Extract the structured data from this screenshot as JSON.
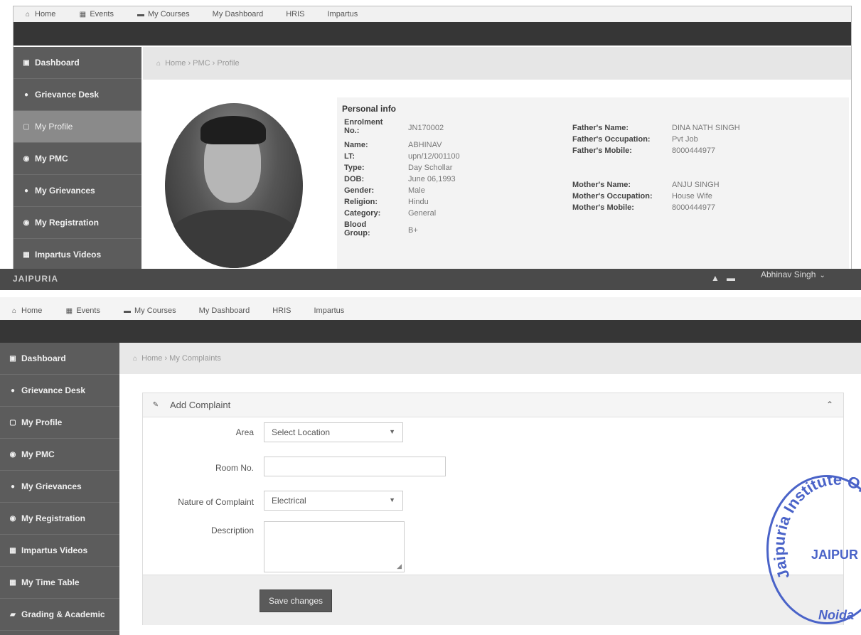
{
  "nav": {
    "home": "Home",
    "events": "Events",
    "courses": "My Courses",
    "dashboard": "My Dashboard",
    "hris": "HRIS",
    "impartus": "Impartus"
  },
  "sidebar_top": [
    {
      "label": "Dashboard",
      "icon": "dashboard-icon"
    },
    {
      "label": "Grievance Desk",
      "icon": "info-icon"
    },
    {
      "label": "My Profile",
      "icon": "file-icon"
    },
    {
      "label": "My PMC",
      "icon": "users-icon"
    },
    {
      "label": "My Grievances",
      "icon": "info-icon"
    },
    {
      "label": "My Registration",
      "icon": "users-icon"
    },
    {
      "label": "Impartus Videos",
      "icon": "calendar-icon"
    }
  ],
  "sidebar_bottom": [
    {
      "label": "Dashboard",
      "icon": "dashboard-icon"
    },
    {
      "label": "Grievance Desk",
      "icon": "info-icon"
    },
    {
      "label": "My Profile",
      "icon": "file-icon"
    },
    {
      "label": "My PMC",
      "icon": "users-icon"
    },
    {
      "label": "My Grievances",
      "icon": "info-icon"
    },
    {
      "label": "My Registration",
      "icon": "users-icon"
    },
    {
      "label": "Impartus Videos",
      "icon": "calendar-icon"
    },
    {
      "label": "My Time Table",
      "icon": "calendar-icon"
    },
    {
      "label": "Grading & Academic",
      "icon": "book-icon"
    }
  ],
  "breadcrumb_top": "Home  ›  PMC  ›  Profile",
  "breadcrumb_bottom": "Home  ›  My Complaints",
  "profile": {
    "title": "Personal info",
    "enrolment_label": "Enrolment No.:",
    "enrolment": "JN170002",
    "name_label": "Name:",
    "name": "ABHINAV",
    "lt_label": "LT:",
    "lt": "upn/12/001100",
    "type_label": "Type:",
    "type": "Day Schollar",
    "dob_label": "DOB:",
    "dob": "June 06,1993",
    "gender_label": "Gender:",
    "gender": "Male",
    "religion_label": "Religion:",
    "religion": "Hindu",
    "category_label": "Category:",
    "category": "General",
    "blood_label": "Blood Group:",
    "blood": "B+",
    "father_name_label": "Father's Name:",
    "father_name": "DINA NATH SINGH",
    "father_occ_label": "Father's Occupation:",
    "father_occ": "Pvt Job",
    "father_mobile_label": "Father's Mobile:",
    "father_mobile": "8000444977",
    "mother_name_label": "Mother's Name:",
    "mother_name": "ANJU SINGH",
    "mother_occ_label": "Mother's Occupation:",
    "mother_occ": "House Wife",
    "mother_mobile_label": "Mother's Mobile:",
    "mother_mobile": "8000444977"
  },
  "header": {
    "brand": "JAIPURIA",
    "user": "Abhinav Singh"
  },
  "complaint": {
    "title": "Add Complaint",
    "area_label": "Area",
    "area_value": "Select Location",
    "room_label": "Room No.",
    "room_value": "",
    "nature_label": "Nature of Complaint",
    "nature_value": "Electrical",
    "desc_label": "Description",
    "desc_value": "",
    "save_label": "Save changes"
  },
  "stamp": {
    "text_arc": "Jaipuria Institute Of",
    "logo": "JAIPUR",
    "city": "Noida"
  }
}
